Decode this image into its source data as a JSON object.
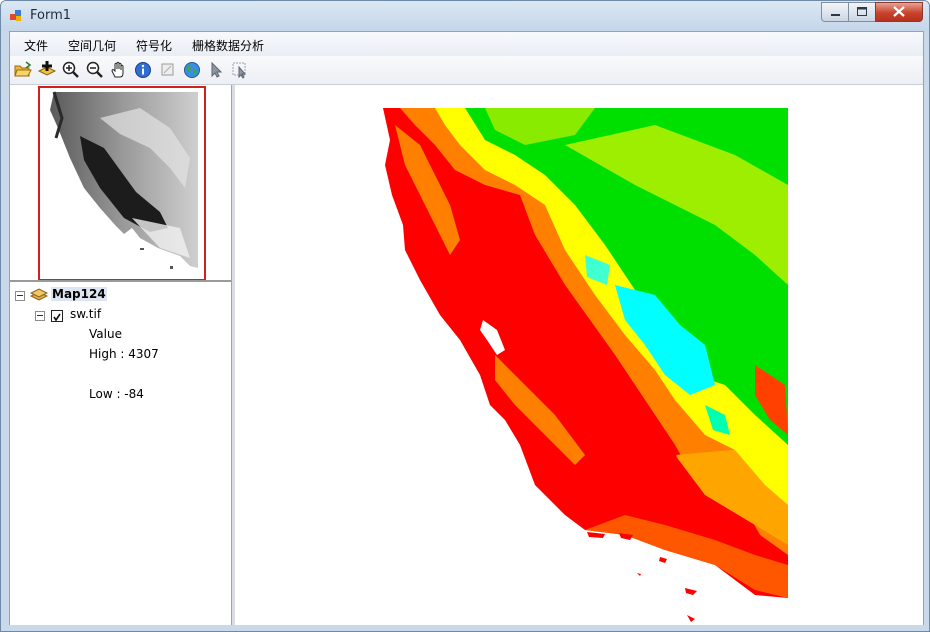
{
  "window": {
    "title": "Form1"
  },
  "menu": {
    "file": "文件",
    "spatial_geometry": "空间几何",
    "symbolization": "符号化",
    "raster_analysis": "栅格数据分析"
  },
  "toolbar": {
    "buttons": [
      "open-icon",
      "add-data-icon",
      "zoom-in-icon",
      "zoom-out-icon",
      "pan-hand-icon",
      "identify-icon",
      "full-extent-icon",
      "globe-icon",
      "select-arrow-icon",
      "select-features-icon"
    ]
  },
  "toc": {
    "map_name": "Map124",
    "layer_name": "sw.tif",
    "legend_field": "Value",
    "high_label": "High : 4307",
    "low_label": "Low : -84"
  },
  "colors": {
    "elev_low": "#ff0000",
    "elev_mid_low": "#ff8000",
    "elev_mid": "#ffff00",
    "elev_mid_high": "#00e000",
    "elev_high": "#00ffff",
    "overview_border": "#d21f1f"
  }
}
